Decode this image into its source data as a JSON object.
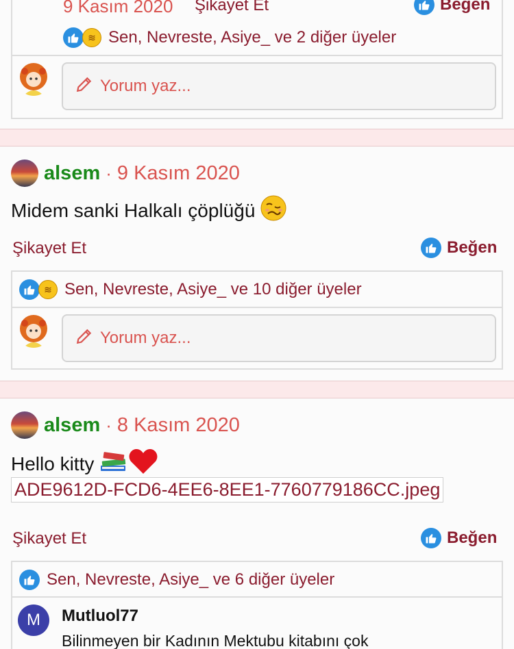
{
  "post0": {
    "date": "9 Kasım 2020",
    "report_label": "Şikayet Et",
    "like_label": "Beğen",
    "likers_text": "Sen, Nevreste, Asiye_ ve 2 diğer üyeler",
    "comment_placeholder": "Yorum yaz..."
  },
  "post1": {
    "author": "alsem",
    "separator": "·",
    "date": "9 Kasım 2020",
    "text": "Midem sanki Halkalı çöplüğü",
    "emoji": "woozy-face",
    "report_label": "Şikayet Et",
    "like_label": "Beğen",
    "likers_text": "Sen, Nevreste, Asiye_ ve 10 diğer üyeler",
    "comment_placeholder": "Yorum yaz..."
  },
  "post2": {
    "author": "alsem",
    "separator": "·",
    "date": "8 Kasım 2020",
    "text": "Hello kitty",
    "emojis": [
      "books-icon",
      "heart-icon"
    ],
    "attachment": "ADE9612D-FCD6-4EE6-8EE1-7760779186CC.jpeg",
    "report_label": "Şikayet Et",
    "like_label": "Beğen",
    "likers_text": "Sen, Nevreste, Asiye_ ve 6 diğer üyeler",
    "comment": {
      "avatar_letter": "M",
      "author": "Mutluol77",
      "text": "Bilinmeyen bir Kadının Mektubu kitabını çok"
    }
  },
  "colors": {
    "accent": "#8a1c2e",
    "date": "#d9534f",
    "author": "#1a8a1a",
    "like_blue": "#2a8fe0",
    "separator_bg": "#fce9ea"
  }
}
